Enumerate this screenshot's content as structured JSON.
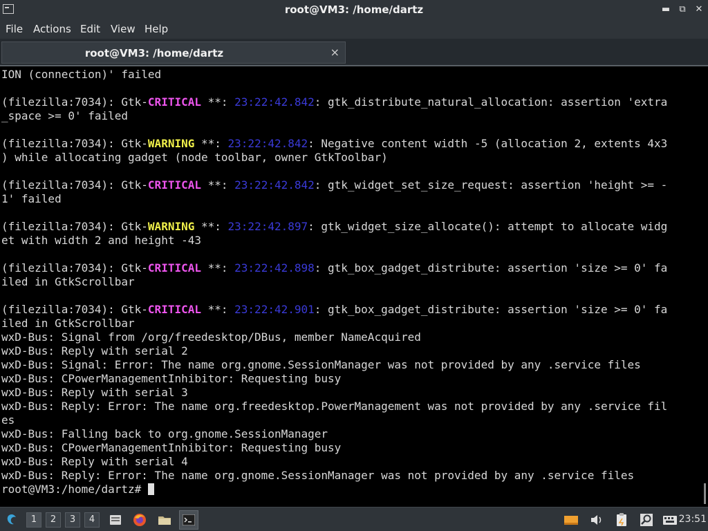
{
  "window": {
    "title": "root@VM3: /home/dartz"
  },
  "menu": [
    "File",
    "Actions",
    "Edit",
    "View",
    "Help"
  ],
  "tab": {
    "title": "root@VM3: /home/dartz",
    "close": "×"
  },
  "terminal": {
    "lines": [
      [
        {
          "t": "ION (connection)' failed"
        }
      ],
      [
        {
          "t": ""
        }
      ],
      [
        {
          "t": "(filezilla:7034): Gtk-"
        },
        {
          "t": "CRITICAL",
          "c": "crit"
        },
        {
          "t": " **: "
        },
        {
          "t": "23:22:42.842",
          "c": "ts"
        },
        {
          "t": ": gtk_distribute_natural_allocation: assertion 'extra"
        }
      ],
      [
        {
          "t": "_space >= 0' failed"
        }
      ],
      [
        {
          "t": ""
        }
      ],
      [
        {
          "t": "(filezilla:7034): Gtk-"
        },
        {
          "t": "WARNING",
          "c": "warn"
        },
        {
          "t": " **: "
        },
        {
          "t": "23:22:42.842",
          "c": "ts"
        },
        {
          "t": ": Negative content width -5 (allocation 2, extents 4x3"
        }
      ],
      [
        {
          "t": ") while allocating gadget (node toolbar, owner GtkToolbar)"
        }
      ],
      [
        {
          "t": ""
        }
      ],
      [
        {
          "t": "(filezilla:7034): Gtk-"
        },
        {
          "t": "CRITICAL",
          "c": "crit"
        },
        {
          "t": " **: "
        },
        {
          "t": "23:22:42.842",
          "c": "ts"
        },
        {
          "t": ": gtk_widget_set_size_request: assertion 'height >= -"
        }
      ],
      [
        {
          "t": "1' failed"
        }
      ],
      [
        {
          "t": ""
        }
      ],
      [
        {
          "t": "(filezilla:7034): Gtk-"
        },
        {
          "t": "WARNING",
          "c": "warn"
        },
        {
          "t": " **: "
        },
        {
          "t": "23:22:42.897",
          "c": "ts"
        },
        {
          "t": ": gtk_widget_size_allocate(): attempt to allocate widg"
        }
      ],
      [
        {
          "t": "et with width 2 and height -43"
        }
      ],
      [
        {
          "t": ""
        }
      ],
      [
        {
          "t": "(filezilla:7034): Gtk-"
        },
        {
          "t": "CRITICAL",
          "c": "crit"
        },
        {
          "t": " **: "
        },
        {
          "t": "23:22:42.898",
          "c": "ts"
        },
        {
          "t": ": gtk_box_gadget_distribute: assertion 'size >= 0' fa"
        }
      ],
      [
        {
          "t": "iled in GtkScrollbar"
        }
      ],
      [
        {
          "t": ""
        }
      ],
      [
        {
          "t": "(filezilla:7034): Gtk-"
        },
        {
          "t": "CRITICAL",
          "c": "crit"
        },
        {
          "t": " **: "
        },
        {
          "t": "23:22:42.901",
          "c": "ts"
        },
        {
          "t": ": gtk_box_gadget_distribute: assertion 'size >= 0' fa"
        }
      ],
      [
        {
          "t": "iled in GtkScrollbar"
        }
      ],
      [
        {
          "t": "wxD-Bus: Signal from /org/freedesktop/DBus, member NameAcquired"
        }
      ],
      [
        {
          "t": "wxD-Bus: Reply with serial 2"
        }
      ],
      [
        {
          "t": "wxD-Bus: Signal: Error: The name org.gnome.SessionManager was not provided by any .service files"
        }
      ],
      [
        {
          "t": "wxD-Bus: CPowerManagementInhibitor: Requesting busy"
        }
      ],
      [
        {
          "t": "wxD-Bus: Reply with serial 3"
        }
      ],
      [
        {
          "t": "wxD-Bus: Reply: Error: The name org.freedesktop.PowerManagement was not provided by any .service fil"
        }
      ],
      [
        {
          "t": "es"
        }
      ],
      [
        {
          "t": "wxD-Bus: Falling back to org.gnome.SessionManager"
        }
      ],
      [
        {
          "t": "wxD-Bus: CPowerManagementInhibitor: Requesting busy"
        }
      ],
      [
        {
          "t": "wxD-Bus: Reply with serial 4"
        }
      ],
      [
        {
          "t": "wxD-Bus: Reply: Error: The name org.gnome.SessionManager was not provided by any .service files"
        }
      ]
    ],
    "prompt": "root@VM3:/home/dartz# "
  },
  "taskbar": {
    "workspaces": [
      "1",
      "2",
      "3",
      "4"
    ],
    "active_workspace": "1",
    "launchers": [
      "files-icon",
      "firefox-icon",
      "folder-icon",
      "terminal-icon"
    ],
    "tray": [
      "storage-icon",
      "volume-icon",
      "clipboard-icon",
      "search-icon",
      "keyboard-icon"
    ],
    "clock": "23:51"
  },
  "colors": {
    "critical": "#ee55ee",
    "warning": "#f0f04a",
    "timestamp": "#3a3ad8"
  }
}
